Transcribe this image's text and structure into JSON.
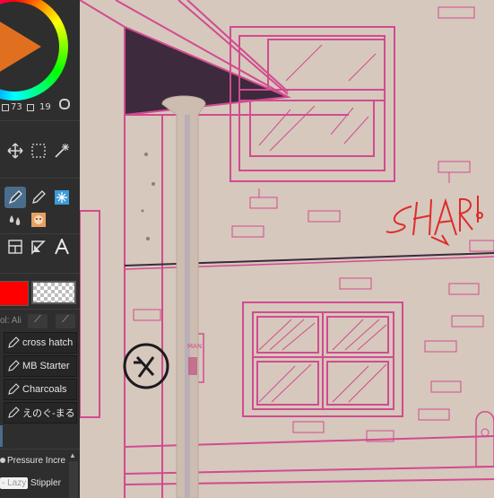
{
  "color_panel": {
    "value_a": "73",
    "value_b": "19",
    "main_color": "#ff0000"
  },
  "tools": {
    "row1": [
      "move-icon",
      "selection-rect-icon",
      "magic-wand-icon"
    ],
    "row2": [
      "pen-icon",
      "pencil-icon",
      "sparkle-brush-icon"
    ],
    "row3": [
      "drops-icon",
      "character-icon"
    ],
    "row4": [
      "frame-icon",
      "ruler-icon",
      "text-icon"
    ]
  },
  "brush_list": {
    "header_text": "ol: Ali",
    "items": [
      {
        "label": "cross hatch",
        "icon": "pen-icon"
      },
      {
        "label": "MB Starter",
        "icon": "pen-icon"
      },
      {
        "label": "Charcoals",
        "icon": "pen-icon"
      },
      {
        "label": "えのぐ-まる",
        "icon": "pen-icon"
      }
    ]
  },
  "tool_settings": {
    "pressure_label": "Pressure Incre",
    "lazy_prefix": "- Lazy",
    "stippler_label": "Stippler"
  },
  "canvas": {
    "graffiti_text": "SHARI",
    "sign_text": "MAN",
    "line_color": "#d24b8f",
    "wall_color": "#d6c8bd",
    "shadow_color": "#3d2a3d"
  }
}
